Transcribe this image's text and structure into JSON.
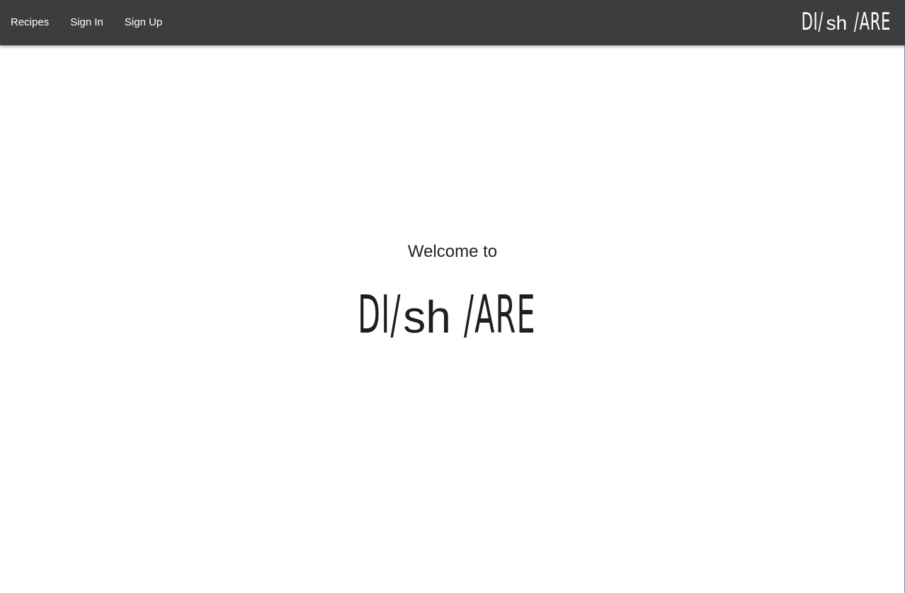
{
  "nav": {
    "links": [
      {
        "label": "Recipes"
      },
      {
        "label": "Sign In"
      },
      {
        "label": "Sign Up"
      }
    ],
    "brand": {
      "part1": "DI/",
      "part2": "sh",
      "part3": "/ARE"
    }
  },
  "hero": {
    "welcome": "Welcome to",
    "logo": {
      "part1": "DI/",
      "part2": "sh",
      "part3": "/ARE"
    }
  },
  "colors": {
    "navbar_bg": "#3d3d3f",
    "nav_text": "#ffffff",
    "body_text": "#222222"
  }
}
